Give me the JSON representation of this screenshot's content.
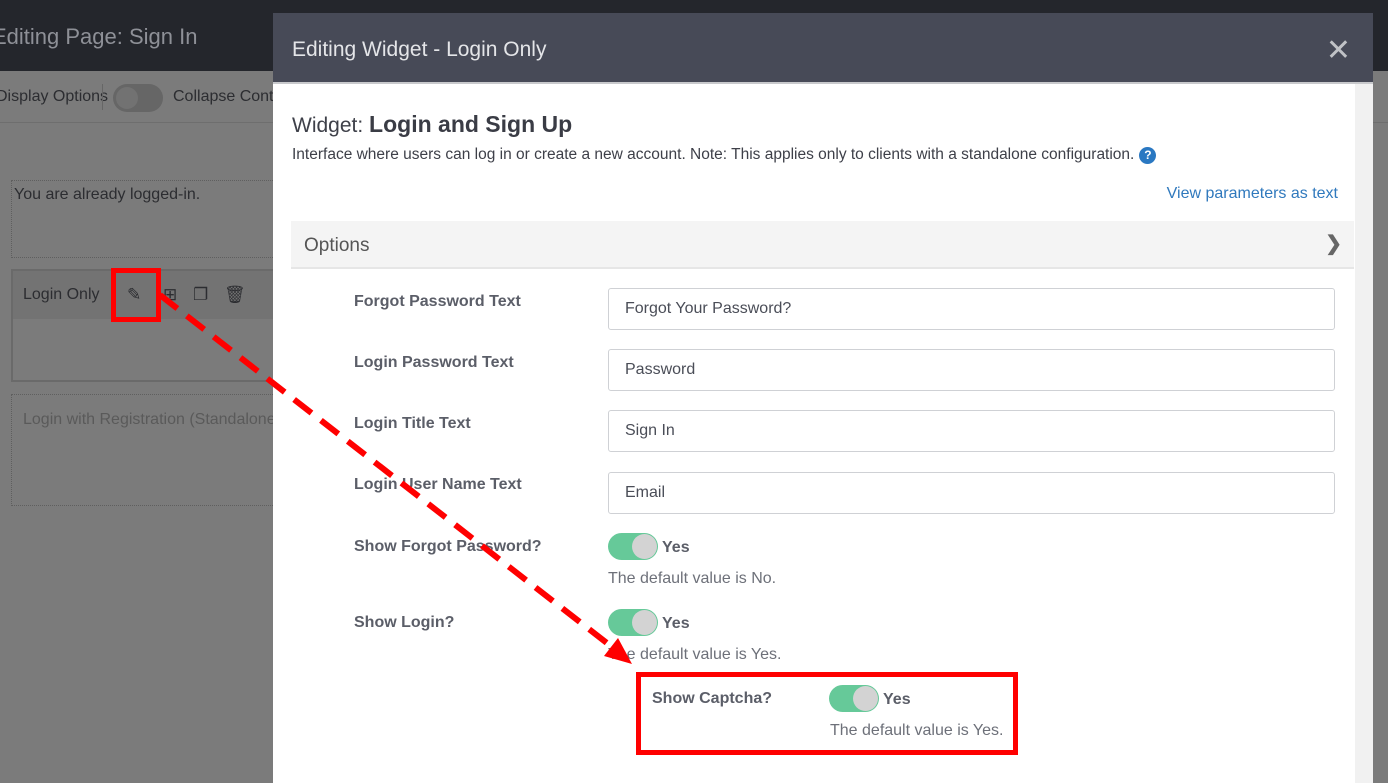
{
  "background": {
    "page_title": "Editing Page: Sign In",
    "display_options": "Display Options",
    "collapse_label": "Collapse Content",
    "widgets": [
      {
        "text": "You are already logged-in."
      },
      {
        "label": "Login Only"
      },
      {
        "text": "Login with Registration (Standalone)"
      }
    ]
  },
  "modal": {
    "title": "Editing Widget - Login Only",
    "close_icon": "close-icon",
    "widget_prefix": "Widget:",
    "widget_name": "Login and Sign Up",
    "description": "Interface where users can log in or create a new account. Note: This applies only to clients with a standalone configuration.",
    "view_params": "View parameters as text",
    "section": "Options",
    "fields": [
      {
        "label": "Forgot Password Text",
        "value": "Forgot Your Password?"
      },
      {
        "label": "Login Password Text",
        "value": "Password"
      },
      {
        "label": "Login Title Text",
        "value": "Sign In"
      },
      {
        "label": "Login User Name Text",
        "value": "Email"
      }
    ],
    "toggles": [
      {
        "label": "Show Forgot Password?",
        "state": "Yes",
        "on": true,
        "default": "The default value is No."
      },
      {
        "label": "Show Login?",
        "state": "Yes",
        "on": true,
        "default": "The default value is Yes."
      },
      {
        "label": "Show Captcha?",
        "state": "Yes",
        "on": true,
        "default": "The default value is Yes."
      }
    ]
  },
  "colors": {
    "toggle_on": "#66c999",
    "annotation": "#ff0000",
    "link": "#3079bd",
    "modal_header": "#474a57"
  }
}
